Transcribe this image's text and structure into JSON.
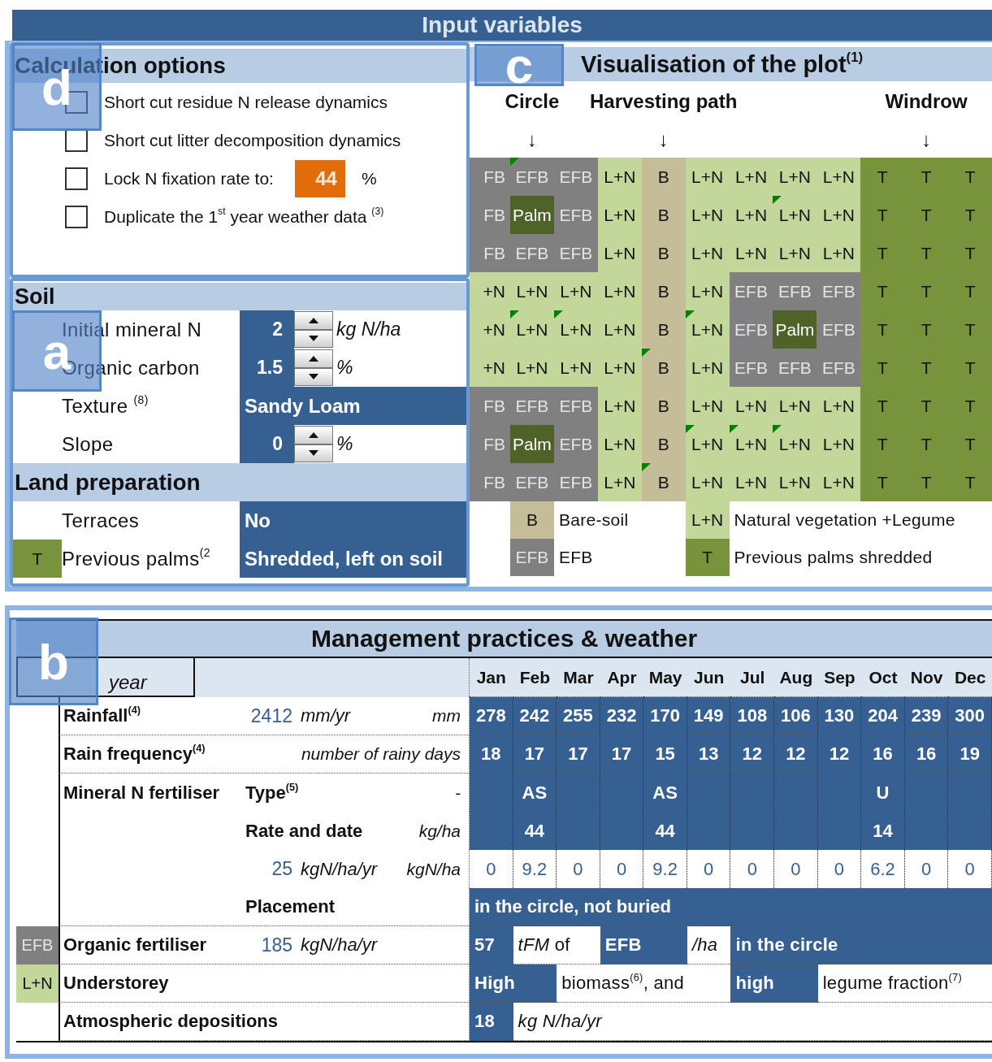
{
  "title": "Input variables",
  "calculation_options": {
    "title": "Calculation options",
    "tag": "d",
    "options": [
      {
        "kind": "checkbox",
        "label": "Short cut residue N release dynamics",
        "checked": false
      },
      {
        "kind": "checkbox",
        "label": "Short cut litter decomposition dynamics",
        "checked": false
      },
      {
        "kind": "lock",
        "label": "Lock N fixation rate to:",
        "value": "44",
        "unit": "%",
        "checked": false
      },
      {
        "kind": "checkbox",
        "label": "Duplicate the 1$^{st}$ year weather data $^{(3)}$",
        "checked": false
      }
    ]
  },
  "soil": {
    "title": "Soil",
    "tag": "a",
    "rows": [
      {
        "kind": "spinner",
        "label": "Initial mineral N",
        "value": "2",
        "unit": "kg N/ha"
      },
      {
        "kind": "spinner",
        "label": "Organic carbon",
        "value": "1.5",
        "unit": "%"
      },
      {
        "kind": "select",
        "label": "Texture $^{(8)}$",
        "value": "Sandy Loam"
      },
      {
        "kind": "spinner",
        "label": "Slope",
        "value": "0",
        "unit": "%"
      }
    ]
  },
  "land_preparation": {
    "title": "Land preparation",
    "rows": [
      {
        "kind": "select",
        "label": "Terraces",
        "value": "No"
      },
      {
        "kind": "select",
        "label": "Previous palms$^{(2}$",
        "value": "Shredded, left on soil",
        "swatch": {
          "kind": "t",
          "text": "T"
        }
      }
    ]
  },
  "plot": {
    "title": "Visualisation of the plot$^{(1)}$",
    "tag": "c",
    "path_labels": [
      {
        "text": "Circle",
        "arrow": "↓"
      },
      {
        "text": "Harvesting path",
        "arrow": "↓"
      },
      {
        "text": "Windrow",
        "arrow": "↓"
      }
    ],
    "rows": [
      {
        "cells": [
          {
            "kind": "efb",
            "text": "FB",
            "note": false
          },
          {
            "kind": "efb",
            "text": "EFB",
            "note": true
          },
          {
            "kind": "efb",
            "text": "EFB",
            "note": false
          },
          {
            "kind": "ln",
            "text": "L+N",
            "note": false
          },
          {
            "kind": "b",
            "text": "B",
            "note": false
          },
          {
            "kind": "ln",
            "text": "L+N",
            "note": false
          },
          {
            "kind": "ln",
            "text": "L+N",
            "note": false
          },
          {
            "kind": "ln",
            "text": "L+N",
            "note": false
          },
          {
            "kind": "ln",
            "text": "L+N",
            "note": false
          },
          {
            "kind": "t",
            "text": "T",
            "note": false
          },
          {
            "kind": "t",
            "text": "T",
            "note": false
          },
          {
            "kind": "t",
            "text": "T",
            "note": false
          }
        ]
      },
      {
        "cells": [
          {
            "kind": "efb",
            "text": "FB",
            "note": false
          },
          {
            "kind": "palm",
            "text": "Palm",
            "note": false
          },
          {
            "kind": "efb",
            "text": "EFB",
            "note": false
          },
          {
            "kind": "ln",
            "text": "L+N",
            "note": false
          },
          {
            "kind": "b",
            "text": "B",
            "note": false
          },
          {
            "kind": "ln",
            "text": "L+N",
            "note": false
          },
          {
            "kind": "ln",
            "text": "L+N",
            "note": false
          },
          {
            "kind": "ln",
            "text": "L+N",
            "note": true
          },
          {
            "kind": "ln",
            "text": "L+N",
            "note": false
          },
          {
            "kind": "t",
            "text": "T",
            "note": false
          },
          {
            "kind": "t",
            "text": "T",
            "note": false
          },
          {
            "kind": "t",
            "text": "T",
            "note": false
          }
        ]
      },
      {
        "cells": [
          {
            "kind": "efb",
            "text": "FB",
            "note": false
          },
          {
            "kind": "efb",
            "text": "EFB",
            "note": false
          },
          {
            "kind": "efb",
            "text": "EFB",
            "note": false
          },
          {
            "kind": "ln",
            "text": "L+N",
            "note": false
          },
          {
            "kind": "b",
            "text": "B",
            "note": false
          },
          {
            "kind": "ln",
            "text": "L+N",
            "note": false
          },
          {
            "kind": "ln",
            "text": "L+N",
            "note": false
          },
          {
            "kind": "ln",
            "text": "L+N",
            "note": false
          },
          {
            "kind": "ln",
            "text": "L+N",
            "note": false
          },
          {
            "kind": "t",
            "text": "T",
            "note": false
          },
          {
            "kind": "t",
            "text": "T",
            "note": false
          },
          {
            "kind": "t",
            "text": "T",
            "note": false
          }
        ]
      },
      {
        "cells": [
          {
            "kind": "ln",
            "text": "+N",
            "note": false
          },
          {
            "kind": "ln",
            "text": "L+N",
            "note": false
          },
          {
            "kind": "ln",
            "text": "L+N",
            "note": false
          },
          {
            "kind": "ln",
            "text": "L+N",
            "note": false
          },
          {
            "kind": "b",
            "text": "B",
            "note": false
          },
          {
            "kind": "ln",
            "text": "L+N",
            "note": false
          },
          {
            "kind": "efb",
            "text": "EFB",
            "note": false
          },
          {
            "kind": "efb",
            "text": "EFB",
            "note": false
          },
          {
            "kind": "efb",
            "text": "EFB",
            "note": false
          },
          {
            "kind": "t",
            "text": "T",
            "note": false
          },
          {
            "kind": "t",
            "text": "T",
            "note": false
          },
          {
            "kind": "t",
            "text": "T",
            "note": false
          }
        ]
      },
      {
        "cells": [
          {
            "kind": "ln",
            "text": "+N",
            "note": false
          },
          {
            "kind": "ln",
            "text": "L+N",
            "note": true
          },
          {
            "kind": "ln",
            "text": "L+N",
            "note": true
          },
          {
            "kind": "ln",
            "text": "L+N",
            "note": false
          },
          {
            "kind": "b",
            "text": "B",
            "note": false
          },
          {
            "kind": "ln",
            "text": "L+N",
            "note": true
          },
          {
            "kind": "efb",
            "text": "EFB",
            "note": false
          },
          {
            "kind": "palm",
            "text": "Palm",
            "note": false
          },
          {
            "kind": "efb",
            "text": "EFB",
            "note": false
          },
          {
            "kind": "t",
            "text": "T",
            "note": false
          },
          {
            "kind": "t",
            "text": "T",
            "note": false
          },
          {
            "kind": "t",
            "text": "T",
            "note": false
          }
        ]
      },
      {
        "cells": [
          {
            "kind": "ln",
            "text": "+N",
            "note": false
          },
          {
            "kind": "ln",
            "text": "L+N",
            "note": false
          },
          {
            "kind": "ln",
            "text": "L+N",
            "note": false
          },
          {
            "kind": "ln",
            "text": "L+N",
            "note": false
          },
          {
            "kind": "b",
            "text": "B",
            "note": true
          },
          {
            "kind": "ln",
            "text": "L+N",
            "note": false
          },
          {
            "kind": "efb",
            "text": "EFB",
            "note": false
          },
          {
            "kind": "efb",
            "text": "EFB",
            "note": false
          },
          {
            "kind": "efb",
            "text": "EFB",
            "note": false
          },
          {
            "kind": "t",
            "text": "T",
            "note": false
          },
          {
            "kind": "t",
            "text": "T",
            "note": false
          },
          {
            "kind": "t",
            "text": "T",
            "note": false
          }
        ]
      },
      {
        "cells": [
          {
            "kind": "efb",
            "text": "FB",
            "note": false
          },
          {
            "kind": "efb",
            "text": "EFB",
            "note": false
          },
          {
            "kind": "efb",
            "text": "EFB",
            "note": false
          },
          {
            "kind": "ln",
            "text": "L+N",
            "note": false
          },
          {
            "kind": "b",
            "text": "B",
            "note": false
          },
          {
            "kind": "ln",
            "text": "L+N",
            "note": false
          },
          {
            "kind": "ln",
            "text": "L+N",
            "note": false
          },
          {
            "kind": "ln",
            "text": "L+N",
            "note": false
          },
          {
            "kind": "ln",
            "text": "L+N",
            "note": false
          },
          {
            "kind": "t",
            "text": "T",
            "note": false
          },
          {
            "kind": "t",
            "text": "T",
            "note": false
          },
          {
            "kind": "t",
            "text": "T",
            "note": false
          }
        ]
      },
      {
        "cells": [
          {
            "kind": "efb",
            "text": "FB",
            "note": false
          },
          {
            "kind": "palm",
            "text": "Palm",
            "note": false
          },
          {
            "kind": "efb",
            "text": "EFB",
            "note": false
          },
          {
            "kind": "ln",
            "text": "L+N",
            "note": false
          },
          {
            "kind": "b",
            "text": "B",
            "note": false
          },
          {
            "kind": "ln",
            "text": "L+N",
            "note": true
          },
          {
            "kind": "ln",
            "text": "L+N",
            "note": true
          },
          {
            "kind": "ln",
            "text": "L+N",
            "note": true
          },
          {
            "kind": "ln",
            "text": "L+N",
            "note": false
          },
          {
            "kind": "t",
            "text": "T",
            "note": false
          },
          {
            "kind": "t",
            "text": "T",
            "note": false
          },
          {
            "kind": "t",
            "text": "T",
            "note": false
          }
        ]
      },
      {
        "cells": [
          {
            "kind": "efb",
            "text": "FB",
            "note": false
          },
          {
            "kind": "efb",
            "text": "EFB",
            "note": false
          },
          {
            "kind": "efb",
            "text": "EFB",
            "note": false
          },
          {
            "kind": "ln",
            "text": "L+N",
            "note": false
          },
          {
            "kind": "b",
            "text": "B",
            "note": true
          },
          {
            "kind": "ln",
            "text": "L+N",
            "note": false
          },
          {
            "kind": "ln",
            "text": "L+N",
            "note": false
          },
          {
            "kind": "ln",
            "text": "L+N",
            "note": false
          },
          {
            "kind": "ln",
            "text": "L+N",
            "note": false
          },
          {
            "kind": "t",
            "text": "T",
            "note": false
          },
          {
            "kind": "t",
            "text": "T",
            "note": false
          },
          {
            "kind": "t",
            "text": "T",
            "note": false
          }
        ]
      }
    ],
    "legend": [
      {
        "kind": "b",
        "text": "B",
        "label": "Bare-soil"
      },
      {
        "kind": "ln",
        "text": "L+N",
        "label": "Natural vegetation +Legume"
      },
      {
        "kind": "efb",
        "text": "EFB",
        "label": "EFB"
      },
      {
        "kind": "t",
        "text": "T",
        "label": "Previous palms shredded"
      }
    ]
  },
  "management": {
    "title": "Management practices & weather",
    "tag": "b",
    "year_label": "year",
    "months": [
      "Jan",
      "Feb",
      "Mar",
      "Apr",
      "May",
      "Jun",
      "Jul",
      "Aug",
      "Sep",
      "Oct",
      "Nov",
      "Dec"
    ],
    "rows": [
      {
        "kind": "monthly",
        "label": "Rainfall$^{(4)}$",
        "value": "2412",
        "unit": "mm/yr",
        "unit_right": "mm",
        "months": [
          {
            "text": "278"
          },
          {
            "text": "242"
          },
          {
            "text": "255"
          },
          {
            "text": "232"
          },
          {
            "text": "170"
          },
          {
            "text": "149"
          },
          {
            "text": "108"
          },
          {
            "text": "106"
          },
          {
            "text": "130"
          },
          {
            "text": "204"
          },
          {
            "text": "239"
          },
          {
            "text": "300"
          }
        ]
      },
      {
        "kind": "monthly",
        "label": "Rain frequency$^{(4)}$",
        "unit_right": "number of rainy days",
        "months": [
          {
            "text": "18"
          },
          {
            "text": "17"
          },
          {
            "text": "17"
          },
          {
            "text": "17"
          },
          {
            "text": "15"
          },
          {
            "text": "13"
          },
          {
            "text": "12"
          },
          {
            "text": "12"
          },
          {
            "text": "12"
          },
          {
            "text": "16"
          },
          {
            "text": "16"
          },
          {
            "text": "19"
          }
        ]
      },
      {
        "kind": "monthly",
        "label": "Mineral N fertiliser",
        "sublabel": "Type$^{(5)}$",
        "unit_right": "-",
        "months": [
          {
            "kind": "blank"
          },
          {
            "kind": "value",
            "text": "AS"
          },
          {
            "kind": "blank"
          },
          {
            "kind": "blank"
          },
          {
            "kind": "value",
            "text": "AS"
          },
          {
            "kind": "blank"
          },
          {
            "kind": "blank"
          },
          {
            "kind": "blank"
          },
          {
            "kind": "blank"
          },
          {
            "kind": "value",
            "text": "U"
          },
          {
            "kind": "blank"
          },
          {
            "kind": "blank"
          }
        ]
      },
      {
        "kind": "monthly",
        "sublabel": "Rate and date",
        "unit_right": "kg/ha",
        "months": [
          {
            "kind": "blank"
          },
          {
            "kind": "value",
            "text": "44"
          },
          {
            "kind": "blank"
          },
          {
            "kind": "blank"
          },
          {
            "kind": "value",
            "text": "44"
          },
          {
            "kind": "blank"
          },
          {
            "kind": "blank"
          },
          {
            "kind": "blank"
          },
          {
            "kind": "blank"
          },
          {
            "kind": "value",
            "text": "14"
          },
          {
            "kind": "blank"
          },
          {
            "kind": "blank"
          }
        ]
      },
      {
        "kind": "monthly_result",
        "value": "25",
        "unit": "kgN/ha/yr",
        "unit_right": "kgN/ha",
        "months": [
          {
            "text": "0"
          },
          {
            "text": "9.2"
          },
          {
            "text": "0"
          },
          {
            "text": "0"
          },
          {
            "text": "9.2"
          },
          {
            "text": "0"
          },
          {
            "text": "0"
          },
          {
            "text": "0"
          },
          {
            "text": "0"
          },
          {
            "text": "6.2"
          },
          {
            "text": "0"
          },
          {
            "text": "0"
          }
        ]
      },
      {
        "kind": "span",
        "sublabel": "Placement",
        "text": "in the circle, not buried"
      },
      {
        "kind": "segments",
        "swatch": {
          "kind": "efb",
          "text": "EFB"
        },
        "label": "Organic fertiliser",
        "value": "185",
        "unit": "kgN/ha/yr",
        "segments": [
          {
            "kind": "input",
            "text": "57"
          },
          {
            "kind": "plain",
            "text": "*tFM* of"
          },
          {
            "kind": "input",
            "text": "EFB"
          },
          {
            "kind": "note",
            "text": "/ha"
          },
          {
            "kind": "input",
            "text": "in the circle"
          }
        ]
      },
      {
        "kind": "segments",
        "swatch": {
          "kind": "ln",
          "text": "L+N"
        },
        "label": "Understorey",
        "segments": [
          {
            "kind": "input",
            "text": "High"
          },
          {
            "kind": "plain",
            "text": "biomass$^{(6)}$, and"
          },
          {
            "kind": "input",
            "text": "high"
          },
          {
            "kind": "plain",
            "text": "legume fraction$^{(7)}$"
          }
        ]
      },
      {
        "kind": "segments",
        "label": "Atmospheric depositions",
        "segments": [
          {
            "kind": "input",
            "text": "18"
          },
          {
            "kind": "note",
            "text": "kg N/ha/yr"
          }
        ]
      }
    ]
  }
}
